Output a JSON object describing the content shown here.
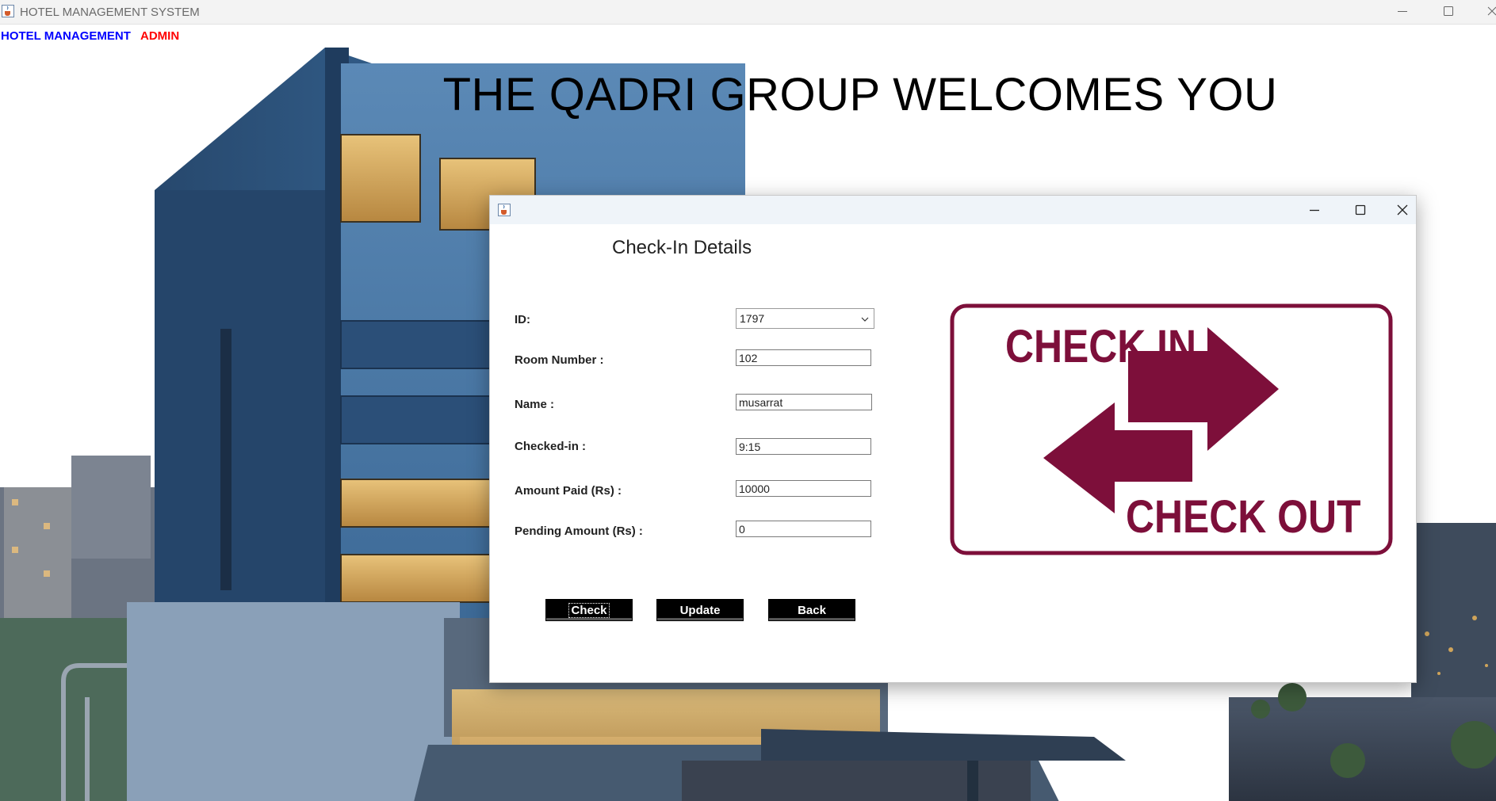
{
  "window": {
    "title": "HOTEL MANAGEMENT SYSTEM",
    "icon": "java-cup-icon"
  },
  "menubar": {
    "items": [
      {
        "label": "HOTEL MANAGEMENT",
        "color": "#0000ff"
      },
      {
        "label": "ADMIN",
        "color": "#ff0000"
      }
    ]
  },
  "background": {
    "welcome_text": "THE QADRI GROUP WELCOMES YOU"
  },
  "dialog": {
    "icon": "java-cup-icon",
    "heading": "Check-In Details",
    "fields": {
      "id": {
        "label": "ID:",
        "value": "1797"
      },
      "room": {
        "label": "Room Number :",
        "value": "102"
      },
      "name": {
        "label": "Name :",
        "value": "musarrat"
      },
      "checked_in": {
        "label": "Checked-in :",
        "value": "9:15"
      },
      "paid": {
        "label": "Amount Paid (Rs) :",
        "value": "10000"
      },
      "pending": {
        "label": "Pending Amount (Rs) :",
        "value": "0"
      }
    },
    "buttons": {
      "check": "Check",
      "update": "Update",
      "back": "Back"
    },
    "graphic": {
      "top_text": "CHECK IN",
      "bottom_text": "CHECK OUT",
      "color": "#7d0f3a"
    }
  }
}
